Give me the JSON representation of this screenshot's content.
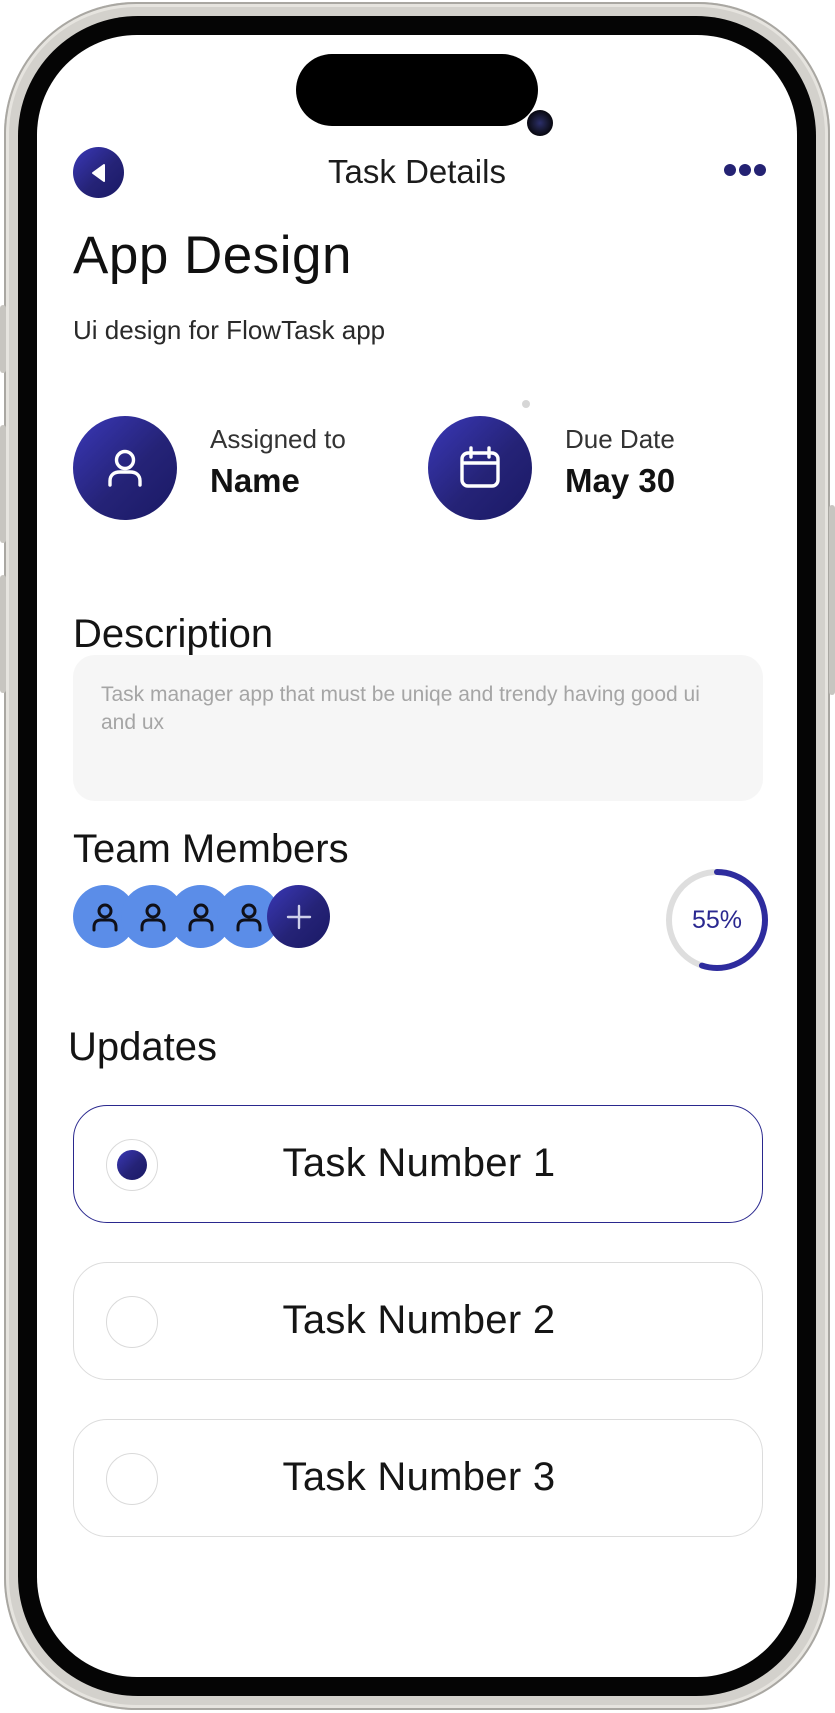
{
  "header": {
    "title": "Task Details"
  },
  "task": {
    "title": "App Design",
    "subtitle": "Ui design for FlowTask app"
  },
  "assigned": {
    "label": "Assigned to",
    "value": "Name",
    "icon": "user-icon"
  },
  "due": {
    "label": "Due Date",
    "value": "May 30",
    "icon": "calendar-icon"
  },
  "description": {
    "heading": "Description",
    "text": "Task manager app that must be uniqe and trendy having good ui and ux"
  },
  "team": {
    "heading": "Team Members",
    "member_icon": "user-icon",
    "member_count": 4,
    "add_icon": "plus-icon",
    "progress_label": "55%",
    "progress_fraction": 0.55
  },
  "updates": {
    "heading": "Updates",
    "tasks": [
      {
        "label": "Task Number 1",
        "selected": true
      },
      {
        "label": "Task Number 2",
        "selected": false
      },
      {
        "label": "Task Number 3",
        "selected": false
      }
    ]
  },
  "colors": {
    "accent_dark": "#242273",
    "accent_light": "#3a38b8",
    "member_blue": "#5b8de8",
    "progress_track": "#dedede",
    "progress_fill": "#2e2c9e"
  }
}
